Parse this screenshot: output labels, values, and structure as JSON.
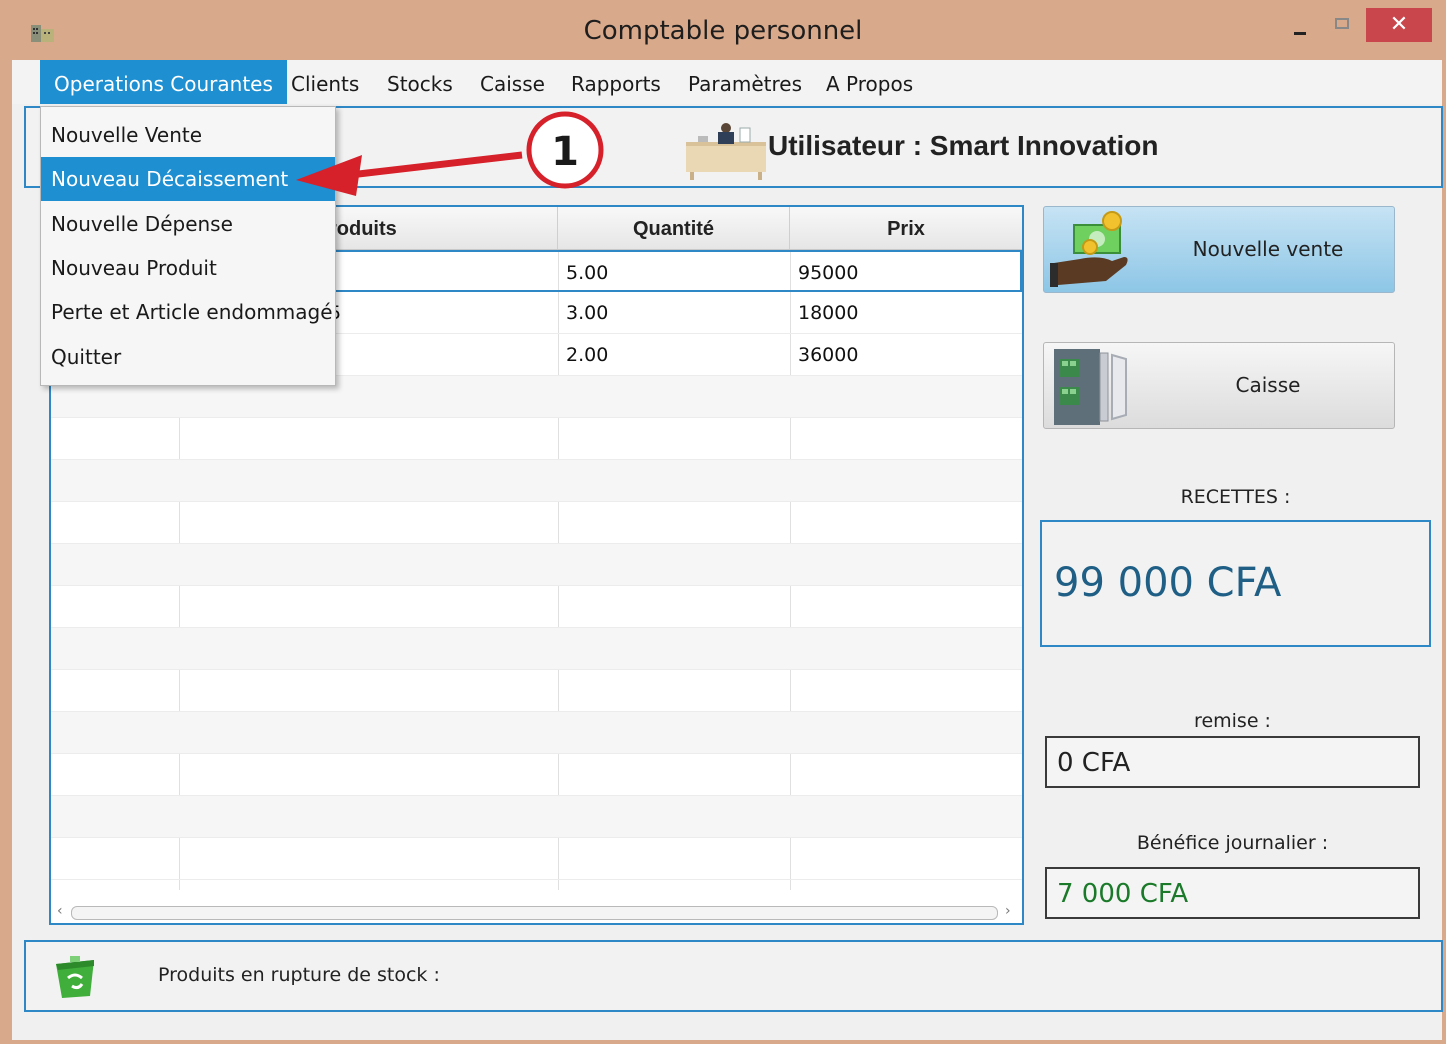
{
  "window": {
    "title": "Comptable personnel",
    "close_symbol": "✕"
  },
  "menubar": [
    "Operations Courantes",
    "Clients",
    "Stocks",
    "Caisse",
    "Rapports",
    "Paramètres",
    "A Propos"
  ],
  "dropdown": [
    "Nouvelle Vente",
    "Nouveau Décaissement",
    "Nouvelle Dépense",
    "Nouveau Produit",
    "Perte et Article endommagé",
    "Quitter"
  ],
  "annotation": {
    "number": "1",
    "color": "#d6202a"
  },
  "user": {
    "label": "Utilisateur : Smart Innovation"
  },
  "table": {
    "headers": [
      "",
      "Produits",
      "Quantité",
      "Prix"
    ],
    "visible_headers": {
      "produits": "roduits",
      "quantite": "Quantité",
      "prix": "Prix"
    },
    "rows": [
      {
        "produit": "",
        "quantite": "5.00",
        "prix": "95000"
      },
      {
        "produit": "5",
        "quantite": "3.00",
        "prix": "18000"
      },
      {
        "produit": "",
        "quantite": "2.00",
        "prix": "36000"
      }
    ]
  },
  "buttons": {
    "nouvelle_vente": "Nouvelle vente",
    "caisse": "Caisse"
  },
  "stats": {
    "recettes_label": "RECETTES :",
    "recettes_value": "99 000 CFA",
    "remise_label": "remise :",
    "remise_value": "0 CFA",
    "benefice_label": "Bénéfice journalier :",
    "benefice_value": "7 000 CFA"
  },
  "colors": {
    "accent": "#1e8fd1",
    "recettes_text": "#1f5f86",
    "benefice_text": "#1a7a2a",
    "window_frame": "#d8a98a"
  },
  "footer": {
    "stock_label": "Produits en rupture de stock :"
  }
}
